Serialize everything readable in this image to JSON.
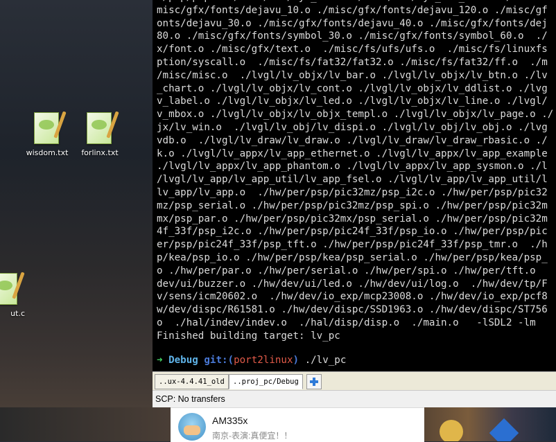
{
  "desktop": {
    "icons": [
      {
        "label": "wisdom.txt"
      },
      {
        "label": "forlinx.txt"
      },
      {
        "label": "ut.c"
      }
    ]
  },
  "terminal": {
    "lines": [
      "c/psp/psp.o ./misc/mem/lyn_mem.o ./misc/mem/lyn_mem_std.o ./mi",
      "misc/gfx/fonts/dejavu_10.o ./misc/gfx/fonts/dejavu_120.o ./misc/gf",
      "onts/dejavu_30.o ./misc/gfx/fonts/dejavu_40.o ./misc/gfx/fonts/dej",
      "80.o ./misc/gfx/fonts/symbol_30.o ./misc/gfx/fonts/symbol_60.o  ./",
      "x/font.o ./misc/gfx/text.o  ./misc/fs/ufs/ufs.o  ./misc/fs/linuxfs",
      "ption/syscall.o  ./misc/fs/fat32/fat32.o ./misc/fs/fat32/ff.o  ./m",
      "/misc/misc.o  ./lvgl/lv_objx/lv_bar.o ./lvgl/lv_objx/lv_btn.o ./lv",
      "_chart.o ./lvgl/lv_objx/lv_cont.o ./lvgl/lv_objx/lv_ddlist.o ./lvg",
      "v_label.o ./lvgl/lv_objx/lv_led.o ./lvgl/lv_objx/lv_line.o ./lvgl/",
      "v_mbox.o ./lvgl/lv_objx/lv_objx_templ.o ./lvgl/lv_objx/lv_page.o ./",
      "jx/lv_win.o  ./lvgl/lv_obj/lv_dispi.o ./lvgl/lv_obj/lv_obj.o ./lvg",
      "vdb.o  ./lvgl/lv_draw/lv_draw.o ./lvgl/lv_draw/lv_draw_rbasic.o ./",
      "k.o ./lvgl/lv_appx/lv_app_ethernet.o ./lvgl/lv_appx/lv_app_example",
      "./lvgl/lv_appx/lv_app_phantom.o ./lvgl/lv_appx/lv_app_sysmon.o ./l",
      "/lvgl/lv_app/lv_app_util/lv_app_fsel.o ./lvgl/lv_app/lv_app_util/l",
      "lv_app/lv_app.o  ./hw/per/psp/pic32mz/psp_i2c.o ./hw/per/psp/pic32",
      "mz/psp_serial.o ./hw/per/psp/pic32mz/psp_spi.o ./hw/per/psp/pic32m",
      "mx/psp_par.o ./hw/per/psp/pic32mx/psp_serial.o ./hw/per/psp/pic32m",
      "4f_33f/psp_i2c.o ./hw/per/psp/pic24f_33f/psp_io.o ./hw/per/psp/pic",
      "er/psp/pic24f_33f/psp_tft.o ./hw/per/psp/pic24f_33f/psp_tmr.o  ./h",
      "p/kea/psp_io.o ./hw/per/psp/kea/psp_serial.o ./hw/per/psp/kea/psp_",
      "o ./hw/per/par.o ./hw/per/serial.o ./hw/per/spi.o ./hw/per/tft.o ",
      "dev/ui/buzzer.o ./hw/dev/ui/led.o ./hw/dev/ui/log.o  ./hw/dev/tp/F",
      "v/sens/icm20602.o  ./hw/dev/io_exp/mcp23008.o ./hw/dev/io_exp/pcf8",
      "w/dev/dispc/R61581.o ./hw/dev/dispc/SSD1963.o ./hw/dev/dispc/ST756",
      "o  ./hal/indev/indev.o  ./hal/disp/disp.o  ./main.o   -lSDL2 -lm",
      "Finished building target: lv_pc"
    ],
    "prompt": {
      "arrow": "➜",
      "dir": "Debug",
      "git": "git:(",
      "branch": "port2linux",
      "close": ")",
      "command": "./lv_pc"
    }
  },
  "tabs": [
    {
      "label": "..ux-4.4.41_old"
    },
    {
      "label": "..proj_pc/Debug"
    }
  ],
  "status": {
    "text": "SCP: No transfers"
  },
  "notification": {
    "title": "AM335x",
    "subtitle": "南京-表演:真便宜！！"
  }
}
